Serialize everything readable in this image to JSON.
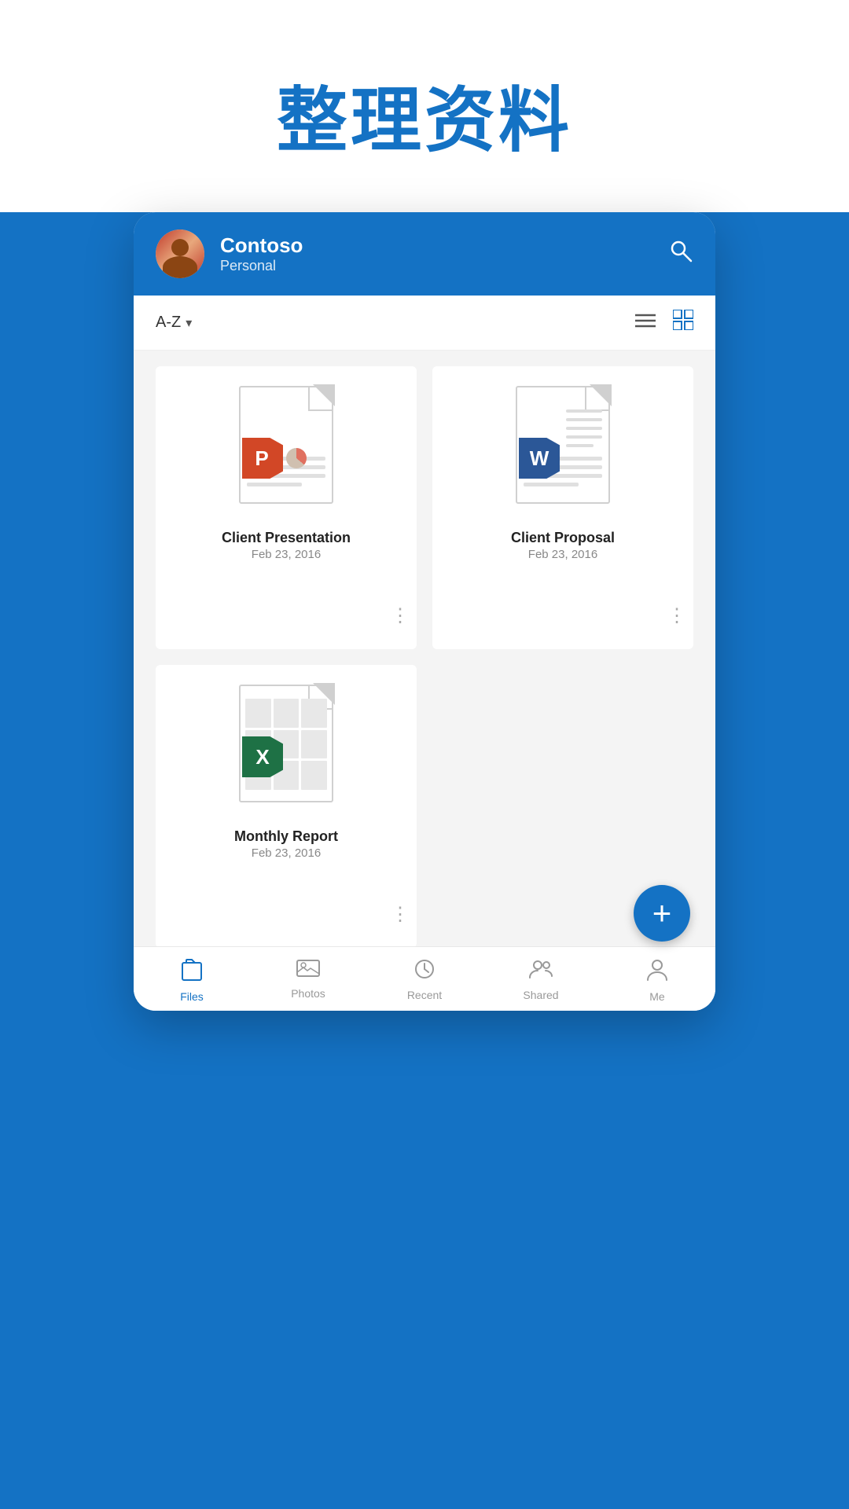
{
  "page": {
    "title": "整理资料",
    "title_color": "#1472C4"
  },
  "header": {
    "account_name": "Contoso",
    "account_type": "Personal",
    "search_label": "Search"
  },
  "toolbar": {
    "sort_label": "A-Z",
    "sort_icon": "chevron-down",
    "list_view_icon": "list",
    "grid_view_icon": "grid"
  },
  "files": [
    {
      "name": "Client Presentation",
      "date": "Feb 23, 2016",
      "type": "ppt",
      "more_label": "⋮"
    },
    {
      "name": "Client Proposal",
      "date": "Feb 23, 2016",
      "type": "word",
      "more_label": "⋮"
    },
    {
      "name": "Monthly Report",
      "date": "Feb 23, 2016",
      "type": "excel",
      "more_label": "⋮"
    }
  ],
  "fab": {
    "label": "+"
  },
  "bottom_nav": {
    "items": [
      {
        "id": "files",
        "label": "Files",
        "icon": "file",
        "active": true
      },
      {
        "id": "photos",
        "label": "Photos",
        "icon": "photo",
        "active": false
      },
      {
        "id": "recent",
        "label": "Recent",
        "icon": "clock",
        "active": false
      },
      {
        "id": "shared",
        "label": "Shared",
        "icon": "shared",
        "active": false
      },
      {
        "id": "me",
        "label": "Me",
        "icon": "person",
        "active": false
      }
    ]
  }
}
